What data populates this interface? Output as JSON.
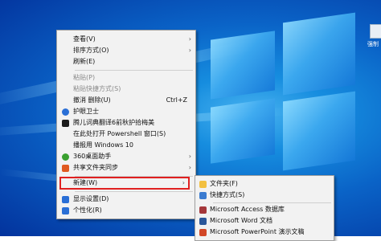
{
  "context_menu": {
    "items": [
      {
        "label": "查看(V)",
        "arrow": "›",
        "icon": "",
        "color": ""
      },
      {
        "label": "排序方式(O)",
        "arrow": "›",
        "icon": "",
        "color": ""
      },
      {
        "label": "刷新(E)",
        "arrow": "",
        "icon": "",
        "color": ""
      },
      {
        "label": "粘贴(P)",
        "arrow": "",
        "icon": "",
        "color": "",
        "disabled": true
      },
      {
        "label": "粘贴快捷方式(S)",
        "arrow": "",
        "icon": "",
        "color": "",
        "disabled": true
      },
      {
        "label": "撤消 删除(U)",
        "shortcut": "Ctrl+Z",
        "arrow": "",
        "icon": "",
        "color": ""
      },
      {
        "label": "护眼卫士",
        "arrow": "",
        "icon": "shield-icon",
        "color": "#2a6fd6"
      },
      {
        "label": "腾儿词典翻译6前秋护拾梅美",
        "arrow": "",
        "icon": "app-icon",
        "color": "#1b1b1b"
      },
      {
        "label": "在此处打开 Powershell 窗口(S)",
        "arrow": "",
        "icon": "",
        "color": ""
      },
      {
        "label": "播报用 Windows 10",
        "arrow": "",
        "icon": "",
        "color": ""
      },
      {
        "label": "360桌面助手",
        "arrow": "›",
        "icon": "360-icon",
        "color": "#3aa030"
      },
      {
        "label": "共享文件夹同步",
        "arrow": "›",
        "icon": "sync-icon",
        "color": "#e05a20"
      },
      {
        "label": "新建(W)",
        "arrow": "›",
        "icon": "",
        "color": ""
      },
      {
        "label": "显示设置(D)",
        "arrow": "",
        "icon": "display-icon",
        "color": "#2a6fd6"
      },
      {
        "label": "个性化(R)",
        "arrow": "",
        "icon": "personalize-icon",
        "color": "#2a6fd6"
      }
    ]
  },
  "new_submenu": {
    "items": [
      {
        "label": "文件夹(F)",
        "icon": "folder-icon",
        "color": "#f2c040"
      },
      {
        "label": "快捷方式(S)",
        "icon": "shortcut-icon",
        "color": "#3b7bd0"
      },
      {
        "label": "Microsoft Access 数据库",
        "icon": "access-icon",
        "color": "#a4373a"
      },
      {
        "label": "Microsoft Word 文档",
        "icon": "word-icon",
        "color": "#2b579a"
      },
      {
        "label": "Microsoft PowerPoint 演示文稿",
        "icon": "powerpoint-icon",
        "color": "#d24726"
      }
    ]
  },
  "desktop": {
    "icon_label": "强制"
  }
}
